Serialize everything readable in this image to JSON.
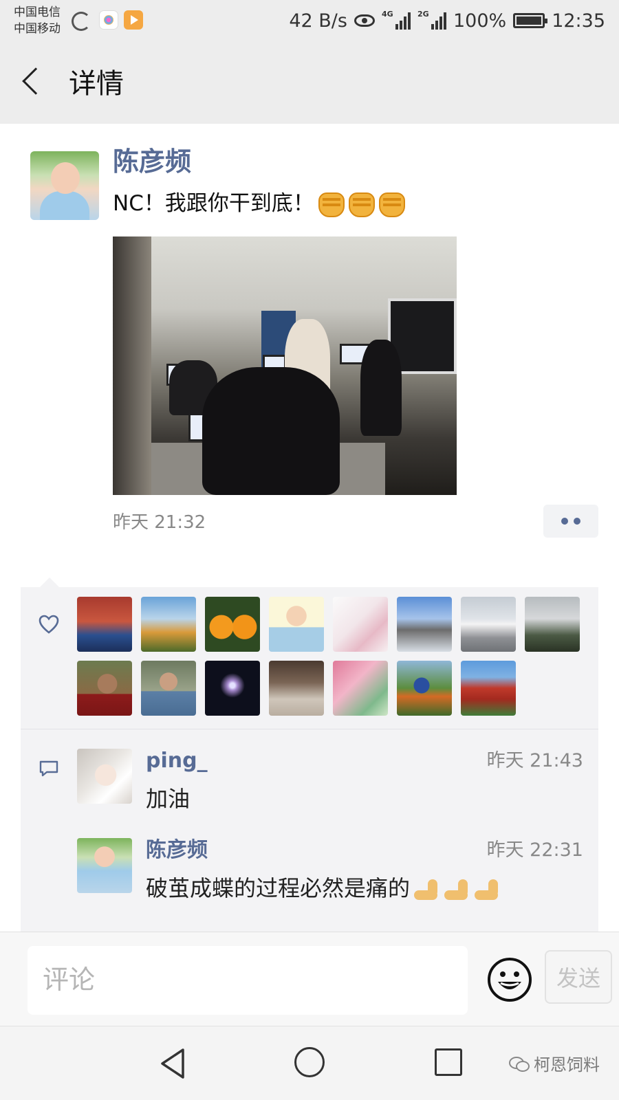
{
  "status_bar": {
    "carrier_1": "中国电信",
    "carrier_2": "中国移动",
    "net_speed": "42 B/s",
    "signal_1_tag": "4G",
    "signal_2_tag": "2G",
    "battery": "100%",
    "time": "12:35"
  },
  "nav": {
    "title": "详情"
  },
  "post": {
    "author": "陈彦频",
    "text": "NC！我跟你干到底！",
    "emoji": "fist-emoji",
    "time": "昨天 21:32"
  },
  "likes": {
    "icon": "heart-icon",
    "count_visible": 15
  },
  "comments": [
    {
      "name": "ping_",
      "time": "昨天 21:43",
      "text": "加油"
    },
    {
      "name": "陈彦频",
      "time": "昨天 22:31",
      "text": "破茧成蝶的过程必然是痛的"
    }
  ],
  "input": {
    "placeholder": "评论",
    "send_label": "发送"
  },
  "watermark": "柯恩饲料",
  "colors": {
    "link_blue": "#576b95",
    "panel_bg": "#f3f3f5",
    "bar_bg": "#ededed"
  }
}
